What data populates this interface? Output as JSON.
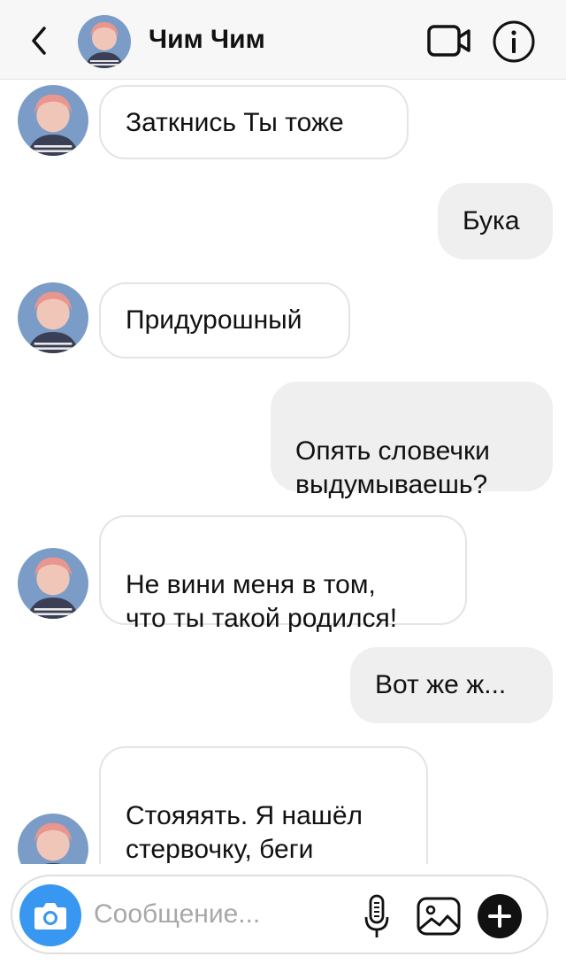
{
  "header": {
    "contact_name": "Чим Чим"
  },
  "messages": [
    {
      "side": "in",
      "text": "Заткнись Ты тоже"
    },
    {
      "side": "out",
      "text": "Бука"
    },
    {
      "side": "in",
      "text": "Придурошный"
    },
    {
      "side": "out",
      "text": "Опять словечки\nвыдумываешь?"
    },
    {
      "side": "in",
      "text": "Не вини меня в том,\nчто ты такой родился!"
    },
    {
      "side": "out",
      "text": "Вот же ж..."
    },
    {
      "side": "in",
      "text": "Стояяять. Я нашёл\nстервочку, беги\nвниз!!!!!"
    }
  ],
  "composer": {
    "placeholder": "Сообщение..."
  },
  "colors": {
    "camera_button": "#3897f0",
    "outgoing_bubble": "#efefef",
    "incoming_border": "#e4e4e4"
  },
  "icons": {
    "back": "chevron-left-icon",
    "video": "video-camera-icon",
    "info": "info-icon",
    "camera": "camera-icon",
    "mic": "microphone-icon",
    "gallery": "image-gallery-icon",
    "plus": "plus-icon"
  }
}
